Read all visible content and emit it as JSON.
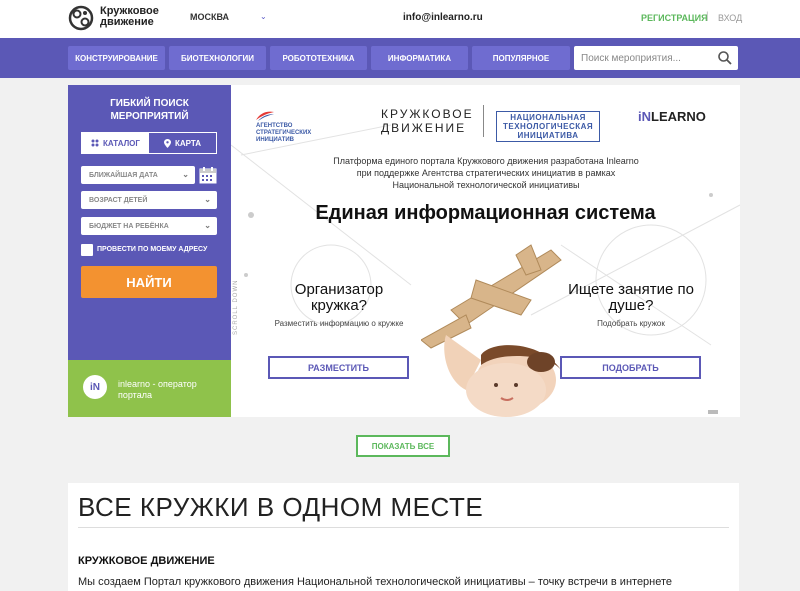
{
  "header": {
    "logo_line1": "Кружковое",
    "logo_line2": "движение",
    "city": "МОСКВА",
    "email": "info@inlearno.ru",
    "register": "РЕГИСТРАЦИЯ",
    "separator": "|",
    "login": "ВХОД"
  },
  "nav": {
    "items": [
      "КОНСТРУИРОВАНИЕ",
      "БИОТЕХНОЛОГИИ",
      "РОБОТОТЕХНИКА",
      "ИНФОРМАТИКА",
      "ПОПУЛЯРНОЕ"
    ],
    "search_placeholder": "Поиск мероприятия..."
  },
  "sidebar": {
    "title_line1": "ГИБКИЙ ПОИСК",
    "title_line2": "МЕРОПРИЯТИЙ",
    "tab_catalog": "КАТАЛОГ",
    "tab_map": "КАРТА",
    "date_placeholder": "БЛИЖАЙШАЯ ДАТА",
    "age_placeholder": "ВОЗРАСТ ДЕТЕЙ",
    "budget_placeholder": "БЮДЖЕТ НА РЕБЁНКА",
    "address_label": "ПРОВЕСТИ ПО МОЕМУ АДРЕСУ",
    "find_button": "НАЙТИ",
    "operator_icon": "iN",
    "operator_line1": "inlearno - оператор",
    "operator_line2": "портала"
  },
  "banner": {
    "asi_line1": "АГЕНТСТВО",
    "asi_line2": "СТРАТЕГИЧЕСКИХ",
    "asi_line3": "ИНИЦИАТИВ",
    "kd_line1": "КРУЖКОВОЕ",
    "kd_line2": "ДВИЖЕНИЕ",
    "nti_line1": "НАЦИОНАЛЬНАЯ",
    "nti_line2": "ТЕХНОЛОГИЧЕСКАЯ",
    "nti_line3": "ИНИЦИАТИВА",
    "inlearno_a": "iN",
    "inlearno_b": "LEARNO",
    "blurb_line1": "Платформа единого портала Кружкового движения разработана Inlearno",
    "blurb_line2": "при поддержке Агентства стратегических инициатив в рамках",
    "blurb_line3": "Национальной технологической инициативы",
    "main_title": "Единая информационная система",
    "left_title_line1": "Организатор",
    "left_title_line2": "кружка?",
    "left_sub": "Разместить информацию о кружке",
    "left_button": "РАЗМЕСТИТЬ",
    "right_title_line1": "Ищете занятие по",
    "right_title_line2": "душе?",
    "right_sub": "Подобрать кружок",
    "right_button": "ПОДОБРАТЬ",
    "scroll_label": "SCROLL DOWN"
  },
  "show_all": "ПОКАЗАТЬ ВСЕ",
  "content": {
    "title": "ВСЕ КРУЖКИ В ОДНОМ МЕСТЕ",
    "subtitle": "КРУЖКОВОЕ ДВИЖЕНИЕ",
    "text": "Мы создаем Портал кружкового движения Национальной технологической инициативы – точку встречи в интернете организаторов кружков"
  },
  "colors": {
    "primary": "#5b58b6",
    "accent_orange": "#f39230",
    "accent_green": "#5cb85c",
    "operator_green": "#8fc24b"
  }
}
